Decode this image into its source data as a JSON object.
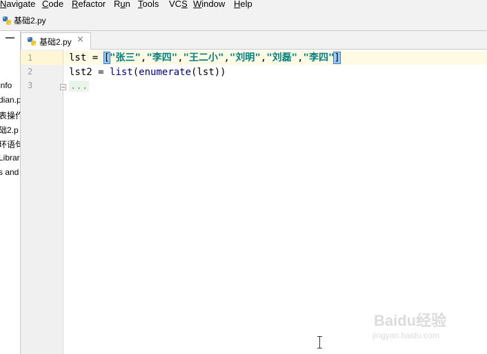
{
  "menu": [
    {
      "label_before": "",
      "mnemonic": "N",
      "label_after": "avigate"
    },
    {
      "label_before": "",
      "mnemonic": "C",
      "label_after": "ode"
    },
    {
      "label_before": "",
      "mnemonic": "R",
      "label_after": "efactor"
    },
    {
      "label_before": "R",
      "mnemonic": "u",
      "label_after": "n"
    },
    {
      "label_before": "",
      "mnemonic": "T",
      "label_after": "ools"
    },
    {
      "label_before": "VC",
      "mnemonic": "S",
      "label_after": ""
    },
    {
      "label_before": "",
      "mnemonic": "W",
      "label_after": "indow"
    },
    {
      "label_before": "",
      "mnemonic": "H",
      "label_after": "elp"
    }
  ],
  "navbar": {
    "file": "基础2.py"
  },
  "project_tree": [
    "info",
    "dian.p",
    "表操作",
    "础2.p",
    "环语句",
    "Librar",
    "s and"
  ],
  "tab": {
    "label": "基础2.py",
    "close": "×"
  },
  "editor": {
    "line_numbers": [
      "1",
      "2",
      "3"
    ],
    "line1": {
      "var": "lst",
      "assign": " = ",
      "open_bracket": "[",
      "items": [
        "\"张三\"",
        ",",
        "\"李四\"",
        ",",
        "\"王二小\"",
        ",",
        "\"刘明\"",
        ",",
        "\"刘磊\"",
        ",",
        "\"李四\""
      ],
      "close_bracket": "]"
    },
    "line2": {
      "prefix": "lst2 = ",
      "builtin1": "list",
      "mid": "(",
      "builtin2": "enumerate",
      "suffix": "(lst))"
    },
    "line3": {
      "folded": "..."
    }
  },
  "watermark": {
    "brand": "Baidu经验",
    "url": "jingyan.baidu.com"
  }
}
